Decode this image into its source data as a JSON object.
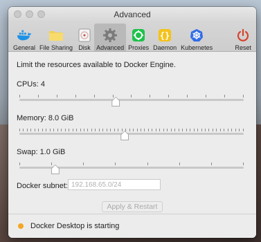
{
  "window": {
    "title": "Advanced"
  },
  "toolbar": {
    "items": [
      {
        "label": "General",
        "icon": "docker-whale-icon",
        "active": false
      },
      {
        "label": "File Sharing",
        "icon": "folder-icon",
        "active": false
      },
      {
        "label": "Disk",
        "icon": "disk-icon",
        "active": false
      },
      {
        "label": "Advanced",
        "icon": "gear-icon",
        "active": true
      },
      {
        "label": "Proxies",
        "icon": "proxies-icon",
        "active": false
      },
      {
        "label": "Daemon",
        "icon": "daemon-braces-icon",
        "active": false
      },
      {
        "label": "Kubernetes",
        "icon": "kubernetes-icon",
        "active": false
      }
    ],
    "reset": {
      "label": "Reset",
      "icon": "power-icon"
    }
  },
  "main": {
    "intro": "Limit the resources available to Docker Engine.",
    "cpus": {
      "label": "CPUs: 4",
      "fraction": 0.43
    },
    "memory": {
      "label": "Memory: 8.0 GiB",
      "fraction": 0.47
    },
    "swap": {
      "label": "Swap: 1.0 GiB",
      "fraction": 0.16
    },
    "subnet": {
      "label": "Docker subnet:",
      "value": "192.168.65.0/24"
    },
    "apply_label": "Apply & Restart"
  },
  "status": {
    "text": "Docker Desktop is starting",
    "color": "#f5a623"
  },
  "colors": {
    "accent_blue": "#1d91e6",
    "proxies_green": "#1ec24b",
    "daemon_yellow": "#f4c21b",
    "kubernetes_blue": "#316ce6",
    "reset_red": "#d9412b"
  }
}
